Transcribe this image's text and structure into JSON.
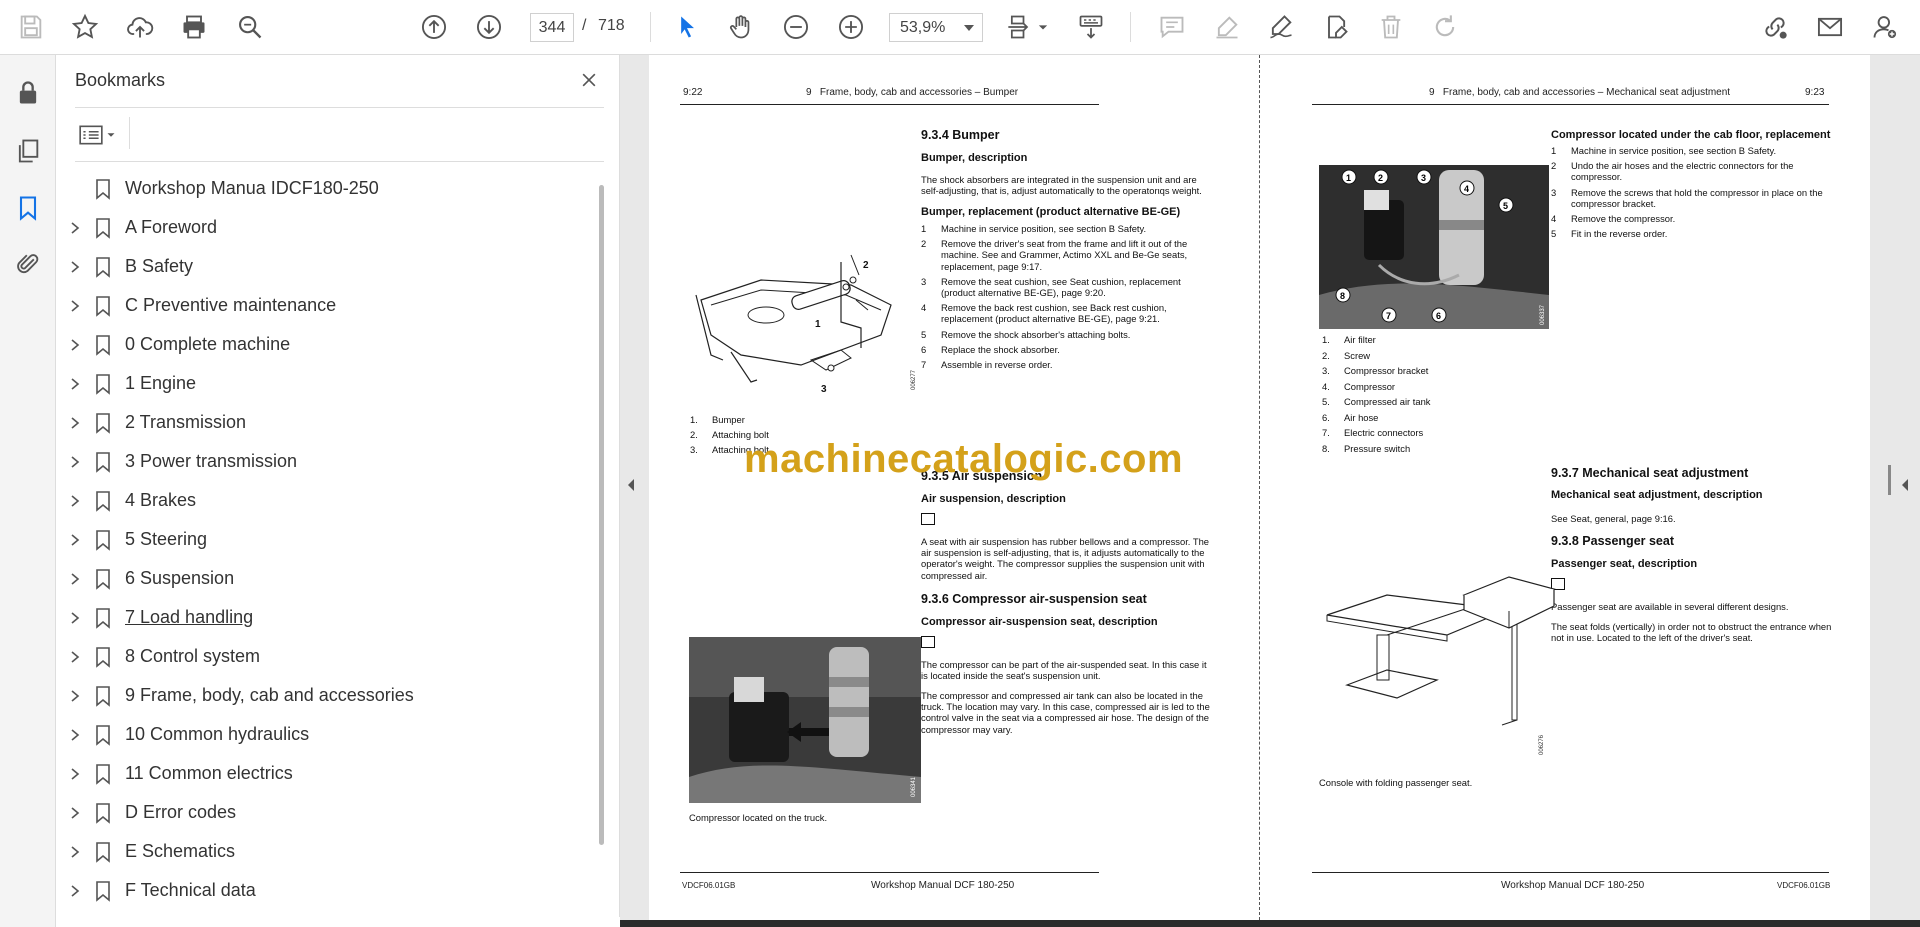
{
  "toolbar": {
    "page_current": "344",
    "page_separator": "/",
    "page_total": "718",
    "zoom_value": "53,9%"
  },
  "bookmarks": {
    "title": "Bookmarks",
    "items": [
      {
        "label": "Workshop Manua IDCF180-250",
        "expandable": false
      },
      {
        "label": "A Foreword",
        "expandable": true
      },
      {
        "label": "B Safety",
        "expandable": true
      },
      {
        "label": "C Preventive maintenance",
        "expandable": true
      },
      {
        "label": "0 Complete machine",
        "expandable": true
      },
      {
        "label": "1 Engine",
        "expandable": true
      },
      {
        "label": "2 Transmission",
        "expandable": true
      },
      {
        "label": "3 Power transmission",
        "expandable": true
      },
      {
        "label": "4 Brakes",
        "expandable": true
      },
      {
        "label": "5 Steering",
        "expandable": true
      },
      {
        "label": "6 Suspension",
        "expandable": true
      },
      {
        "label": "7 Load handling",
        "expandable": true
      },
      {
        "label": "8 Control system",
        "expandable": true
      },
      {
        "label": "9 Frame, body, cab and accessories",
        "expandable": true
      },
      {
        "label": "10 Common hydraulics",
        "expandable": true
      },
      {
        "label": "11 Common electrics",
        "expandable": true
      },
      {
        "label": "D Error codes",
        "expandable": true
      },
      {
        "label": "E Schematics",
        "expandable": true
      },
      {
        "label": "F Technical data",
        "expandable": true
      }
    ]
  },
  "left_page": {
    "page_no": "9:22",
    "header": "9   Frame, body, cab and accessories – Bumper",
    "s934": "9.3.4 Bumper",
    "bumper_desc_h": "Bumper, description",
    "bumper_desc": "The shock absorbers are integrated in the suspension unit and are self-adjusting, that is, adjust automatically to the operatorιqs weight.",
    "bumper_repl_h": "Bumper, replacement (product alternative BE-GE)",
    "steps": [
      {
        "n": "1",
        "t": "Machine in service position, see section B Safety."
      },
      {
        "n": "2",
        "t": "Remove the driver's seat from the frame and lift it out of the machine.  See and Grammer, Actimo XXL and Be-Ge seats, replacement, page 9:17."
      },
      {
        "n": "3",
        "t": "Remove the seat cushion, see Seat cushion, replacement (product alternative BE-GE), page 9:20."
      },
      {
        "n": "4",
        "t": "Remove the back rest cushion, see Back rest cushion, replacement (product alternative BE-GE), page 9:21."
      },
      {
        "n": "5",
        "t": "Remove the shock absorber's attaching bolts."
      },
      {
        "n": "6",
        "t": "Replace the shock absorber."
      },
      {
        "n": "7",
        "t": "Assemble in reverse order."
      }
    ],
    "fig1_code": "006277",
    "fig1_callouts": [
      "1",
      "2",
      "3"
    ],
    "legend": [
      {
        "n": "1.",
        "t": "Bumper"
      },
      {
        "n": "2.",
        "t": "Attaching bolt"
      },
      {
        "n": "3.",
        "t": "Attaching bolt"
      }
    ],
    "s935": "9.3.5 Air suspension",
    "air_desc_h": "Air suspension, description",
    "air_desc": "A seat with air suspension has rubber bellows and a compressor. The air suspension is self-adjusting, that is, it adjusts automatically to the operator's weight. The compressor supplies the suspension unit with compressed air.",
    "s936": "9.3.6 Compressor air-suspension seat",
    "comp_desc_h": "Compressor air-suspension seat, description",
    "comp_p1": "The compressor can be part of the air-suspended seat. In this case it is located inside the seat's suspension unit.",
    "comp_p2": "The compressor and compressed air tank can also be located in the truck. The location may vary. In this case, compressed air is led to the control valve in the seat via a compressed air hose. The design of the compressor may vary.",
    "fig2_code": "006341",
    "fig2_caption": "Compressor located on the truck.",
    "footer_left": "VDCF06.01GB",
    "footer_center": "Workshop Manual DCF 180-250"
  },
  "right_page": {
    "page_no": "9:23",
    "header": "9   Frame, body, cab and accessories – Mechanical seat adjustment",
    "comp_repl_h": "Compressor located under the cab floor, replacement",
    "steps": [
      {
        "n": "1",
        "t": "Machine in service position, see section B Safety."
      },
      {
        "n": "2",
        "t": "Undo the air hoses and the electric connectors for the compressor."
      },
      {
        "n": "3",
        "t": "Remove the screws that hold the compressor in place on the compressor bracket."
      },
      {
        "n": "4",
        "t": "Remove the compressor."
      },
      {
        "n": "5",
        "t": "Fit in the reverse order."
      }
    ],
    "fig3_code": "006337",
    "fig3_callouts": [
      "1",
      "2",
      "3",
      "4",
      "5",
      "6",
      "7",
      "8"
    ],
    "legend": [
      {
        "n": "1.",
        "t": "Air filter"
      },
      {
        "n": "2.",
        "t": "Screw"
      },
      {
        "n": "3.",
        "t": "Compressor bracket"
      },
      {
        "n": "4.",
        "t": "Compressor"
      },
      {
        "n": "5.",
        "t": "Compressed air tank"
      },
      {
        "n": "6.",
        "t": "Air hose"
      },
      {
        "n": "7.",
        "t": "Electric connectors"
      },
      {
        "n": "8.",
        "t": "Pressure switch"
      }
    ],
    "s937": "9.3.7 Mechanical seat adjustment",
    "mech_desc_h": "Mechanical seat adjustment, description",
    "mech_desc": "See Seat, general, page 9:16.",
    "s938": "9.3.8 Passenger seat",
    "pass_desc_h": "Passenger seat, description",
    "pass_p1": "Passenger seat are available in several different designs.",
    "pass_p2": "The seat folds (vertically) in order not to obstruct the entrance when not in use.  Located to the left of the driver's seat.",
    "fig4_code": "006276",
    "fig4_caption": "Console with folding passenger seat.",
    "footer_center": "Workshop Manual DCF 180-250",
    "footer_right": "VDCF06.01GB"
  },
  "watermark": "machinecatalogic.com"
}
